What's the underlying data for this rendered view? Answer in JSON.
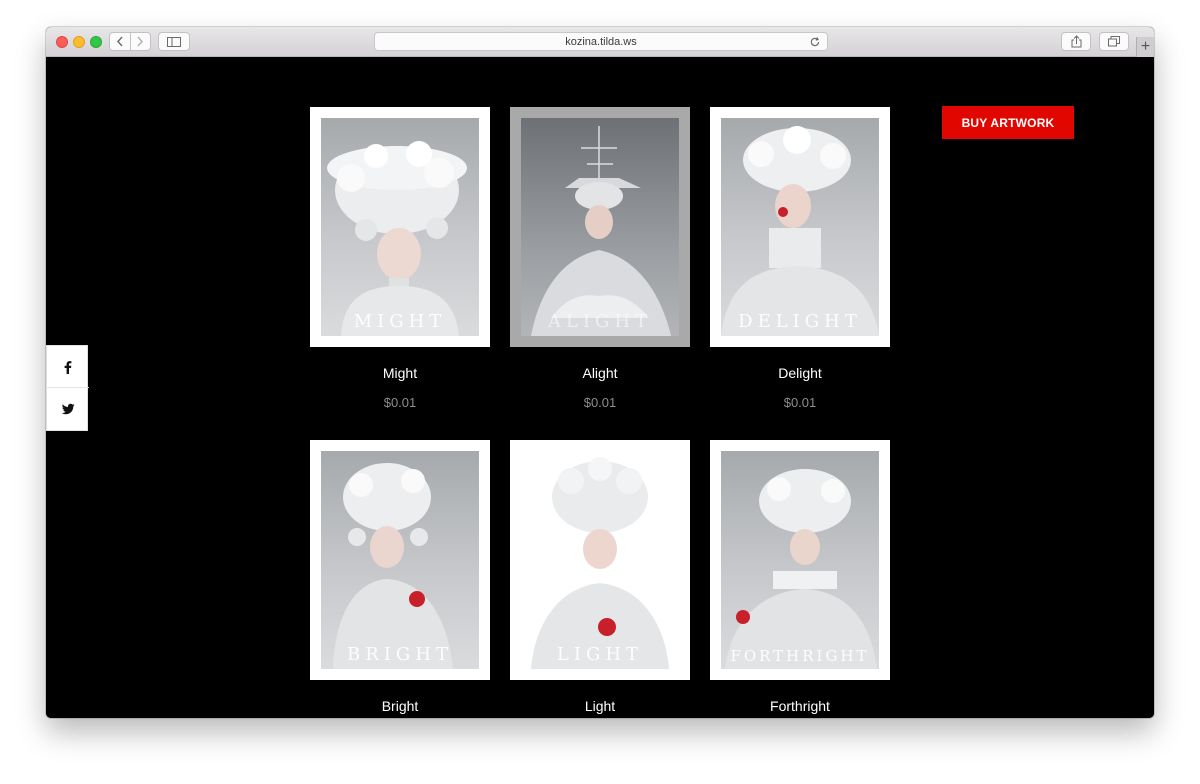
{
  "browser": {
    "url": "kozina.tilda.ws",
    "new_tab_symbol": "+"
  },
  "buy_button": "BUY ARTWORK",
  "share": {
    "facebook_icon": "facebook-icon",
    "twitter_icon": "twitter-icon"
  },
  "products": [
    {
      "title": "Might",
      "price": "$0.01",
      "watermark": "MIGHT"
    },
    {
      "title": "Alight",
      "price": "$0.01",
      "watermark": "ALIGHT"
    },
    {
      "title": "Delight",
      "price": "$0.01",
      "watermark": "DELIGHT"
    },
    {
      "title": "Bright",
      "price": "",
      "watermark": "BRIGHT"
    },
    {
      "title": "Light",
      "price": "",
      "watermark": "LIGHT"
    },
    {
      "title": "Forthright",
      "price": "",
      "watermark": "FORTHRIGHT"
    }
  ],
  "colors": {
    "accent": "#e10600",
    "background": "#000000",
    "price": "#8c8c8c"
  }
}
